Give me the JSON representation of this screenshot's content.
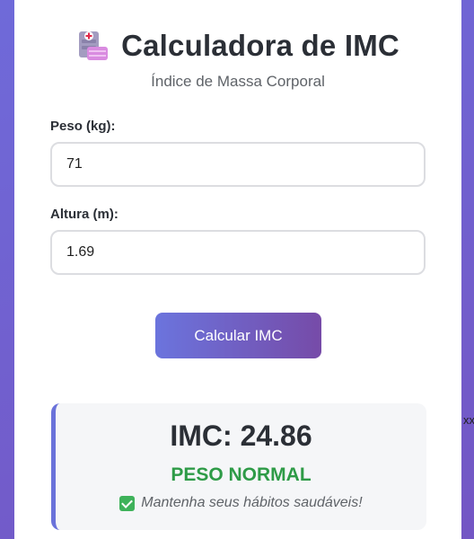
{
  "header": {
    "title": "Calculadora de IMC",
    "subtitle": "Índice de Massa Corporal",
    "logo_icon": "hospital-clipboard-icon"
  },
  "form": {
    "weight": {
      "label": "Peso (kg):",
      "value": "71"
    },
    "height": {
      "label": "Altura (m):",
      "value": "1.69"
    },
    "submit_label": "Calcular IMC"
  },
  "result": {
    "imc_text": "IMC: 24.86",
    "category": "PESO NORMAL",
    "tip": "Mantenha seus hábitos saudáveis!",
    "tip_icon": "check-mark-icon"
  },
  "stray_text": "xx",
  "colors": {
    "accent": "#6a72da",
    "button_gradient_end": "#764ba8",
    "success": "#2e9b47"
  }
}
